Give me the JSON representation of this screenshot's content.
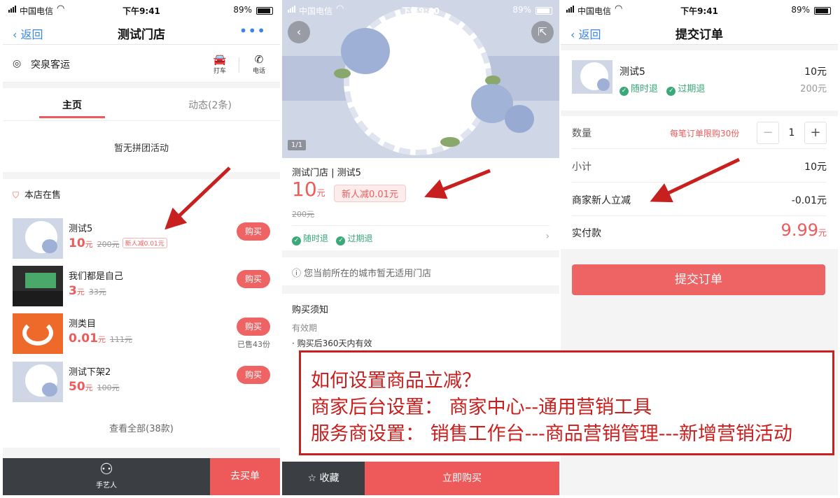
{
  "status": {
    "carrier": "中国电信",
    "battery": "89%",
    "battery_level": 0.89,
    "time_1": "下午9:41",
    "time_2": "下午9:40",
    "time_3": "下午9:41"
  },
  "store_page": {
    "back_label": "返回",
    "title": "测试门店",
    "more": "•••",
    "address": "突泉客运",
    "taxi_label": "打车",
    "phone_label": "电话",
    "tabs": [
      "主页",
      "动态(2条)"
    ],
    "no_group": "暂无拼团活动",
    "section_title": "本店在售",
    "items": [
      {
        "name": "测试5",
        "price": "10",
        "unit": "元",
        "orig": "200元",
        "badge": "新人减0.01元",
        "button": "购买"
      },
      {
        "name": "我们都是自己",
        "price": "3",
        "unit": "元",
        "orig": "33元",
        "button": "购买"
      },
      {
        "name": "测类目",
        "price": "0.01",
        "unit": "元",
        "orig": "111元",
        "button": "购买",
        "sold": "已售43份"
      },
      {
        "name": "测试下架2",
        "price": "50",
        "unit": "元",
        "orig": "100元",
        "button": "购买"
      }
    ],
    "view_all": "查看全部(38款)",
    "bottom_left": "手艺人",
    "bottom_right": "去买单"
  },
  "product_page": {
    "pager": "1/1",
    "store_and_name": "测试门店 | 测试5",
    "price": "10",
    "unit": "元",
    "new_user_badge": "新人减0.01元",
    "orig": "200元",
    "tag1": "随时退",
    "tag2": "过期退",
    "notice": "您当前所在的城市暂无适用门店",
    "buy_note_title": "购买须知",
    "validity_title": "有效期",
    "validity_text": "购买后360天内有效",
    "fav_label": "收藏",
    "buy_now": "立即购买"
  },
  "order_page": {
    "back_label": "返回",
    "title": "提交订单",
    "item_name": "测试5",
    "tag1": "随时退",
    "tag2": "过期退",
    "price": "10元",
    "orig": "200元",
    "qty_label": "数量",
    "qty_limit": "每笔订单限购30份",
    "qty": "1",
    "minus": "−",
    "plus": "+",
    "subtotal_label": "小计",
    "subtotal": "10元",
    "discount_label": "商家新人立减",
    "discount": "-0.01元",
    "pay_label": "实付款",
    "pay_amount": "9.99",
    "pay_unit": "元",
    "submit": "提交订单"
  },
  "annotation": {
    "line1": "如何设置商品立减？",
    "line2": "商家后台设置： 商家中心--通用营销工具",
    "line3": "服务商设置： 销售工作台---商品营销管理---新增营销活动"
  },
  "colors": {
    "accent": "#ee5a5a",
    "annotation": "#c8201f",
    "green": "#3aa878",
    "link": "#3a86e6",
    "dark_bar": "#3b3f44"
  }
}
